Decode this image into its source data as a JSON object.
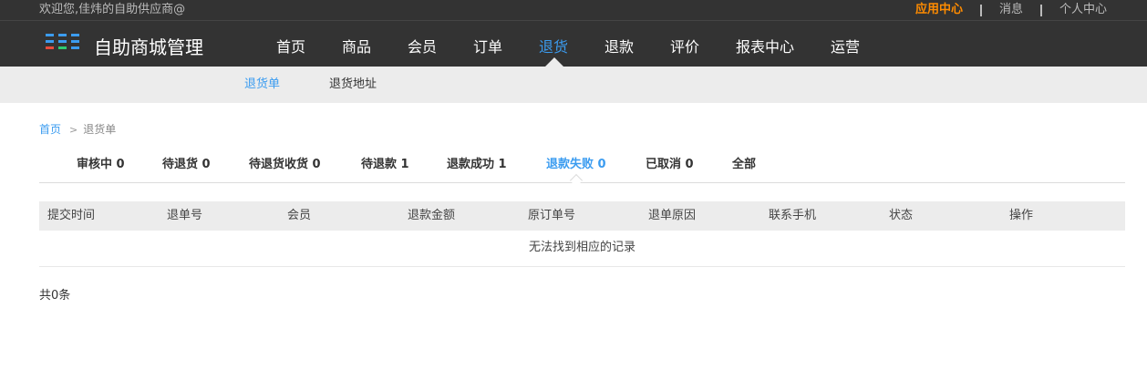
{
  "header": {
    "welcome": "欢迎您,佳炜的自助供应商@",
    "links": [
      "应用中心",
      "消息",
      "个人中心"
    ],
    "brand": "自助商城管理",
    "logo_colors": [
      "#3b9cf0",
      "#e74c3c",
      "#2ecc71",
      "#f1c40f"
    ]
  },
  "nav": {
    "items": [
      "首页",
      "商品",
      "会员",
      "订单",
      "退货",
      "退款",
      "评价",
      "报表中心",
      "运营"
    ],
    "active": "退货"
  },
  "subnav": {
    "items": [
      "退货单",
      "退货地址"
    ],
    "active": "退货单"
  },
  "breadcrumb": {
    "home": "首页",
    "separator": ">",
    "current": "退货单"
  },
  "tabs": {
    "items": [
      "审核中 0",
      "待退货 0",
      "待退货收货 0",
      "待退款 1",
      "退款成功 1",
      "退款失败 0",
      "已取消 0",
      "全部"
    ],
    "active": "退款失败 0"
  },
  "table": {
    "columns": [
      "提交时间",
      "退单号",
      "会员",
      "退款金额",
      "原订单号",
      "退单原因",
      "联系手机",
      "状态",
      "操作"
    ],
    "empty_text": "无法找到相应的记录"
  },
  "footer": {
    "total": "共0条"
  },
  "colors": {
    "accent": "#3b9cf0",
    "highlight": "#ff8c00",
    "topbar": "#333333"
  }
}
